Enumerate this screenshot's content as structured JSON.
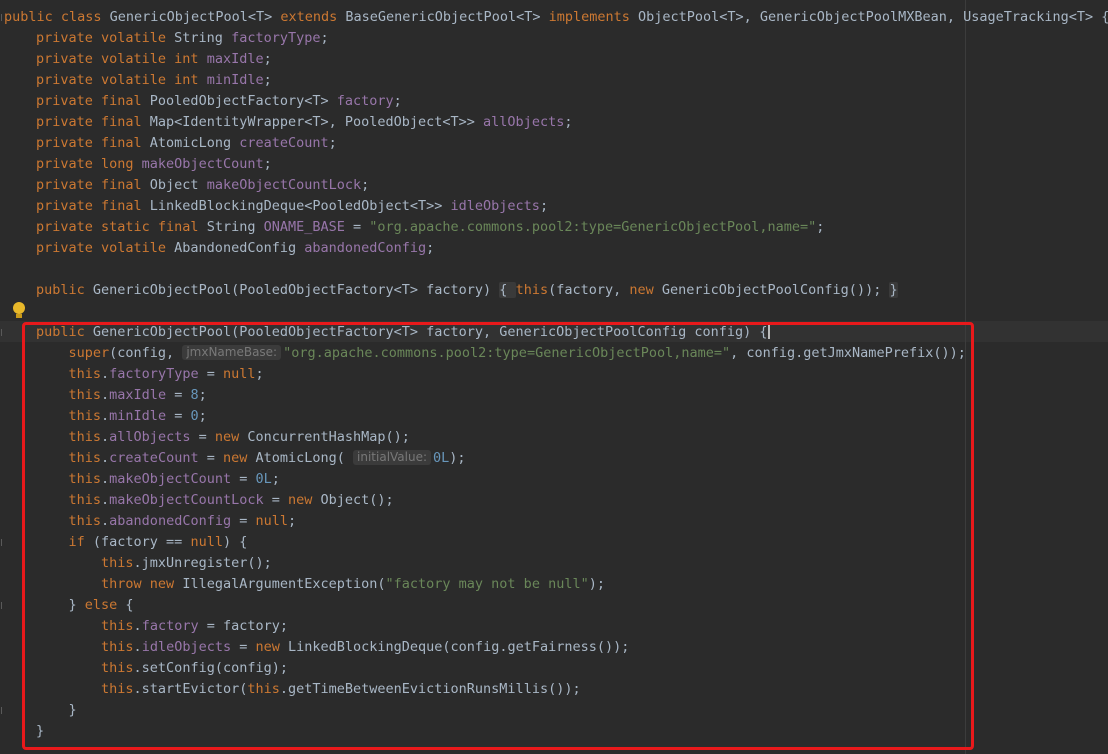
{
  "editor": {
    "lines": [
      {
        "tokens": [
          [
            "kw",
            "public class "
          ],
          [
            "id",
            "GenericObjectPool<T> "
          ],
          [
            "kw",
            "extends "
          ],
          [
            "id",
            "BaseGenericObjectPool<T> "
          ],
          [
            "kw",
            "implements "
          ],
          [
            "id",
            "ObjectPool<T>, GenericObjectPoolMXBean, UsageTracking<T> {"
          ]
        ]
      },
      {
        "tokens": [
          [
            "kw",
            "private volatile "
          ],
          [
            "id",
            "String "
          ],
          [
            "fld",
            "factoryType"
          ],
          [
            "id",
            ";"
          ]
        ]
      },
      {
        "tokens": [
          [
            "kw",
            "private volatile int "
          ],
          [
            "fld",
            "maxIdle"
          ],
          [
            "id",
            ";"
          ]
        ]
      },
      {
        "tokens": [
          [
            "kw",
            "private volatile int "
          ],
          [
            "fld",
            "minIdle"
          ],
          [
            "id",
            ";"
          ]
        ]
      },
      {
        "tokens": [
          [
            "kw",
            "private final "
          ],
          [
            "id",
            "PooledObjectFactory<T> "
          ],
          [
            "fld",
            "factory"
          ],
          [
            "id",
            ";"
          ]
        ]
      },
      {
        "tokens": [
          [
            "kw",
            "private final "
          ],
          [
            "id",
            "Map<IdentityWrapper<T>, PooledObject<T>> "
          ],
          [
            "fld",
            "allObjects"
          ],
          [
            "id",
            ";"
          ]
        ]
      },
      {
        "tokens": [
          [
            "kw",
            "private final "
          ],
          [
            "id",
            "AtomicLong "
          ],
          [
            "fld",
            "createCount"
          ],
          [
            "id",
            ";"
          ]
        ]
      },
      {
        "tokens": [
          [
            "kw",
            "private long "
          ],
          [
            "fld",
            "makeObjectCount"
          ],
          [
            "id",
            ";"
          ]
        ]
      },
      {
        "tokens": [
          [
            "kw",
            "private final "
          ],
          [
            "id",
            "Object "
          ],
          [
            "fld",
            "makeObjectCountLock"
          ],
          [
            "id",
            ";"
          ]
        ]
      },
      {
        "tokens": [
          [
            "kw",
            "private final "
          ],
          [
            "id",
            "LinkedBlockingDeque<PooledObject<T>> "
          ],
          [
            "fld",
            "idleObjects"
          ],
          [
            "id",
            ";"
          ]
        ]
      },
      {
        "tokens": [
          [
            "kw",
            "private static final "
          ],
          [
            "id",
            "String "
          ],
          [
            "fld",
            "ONAME_BASE"
          ],
          [
            "id",
            " = "
          ],
          [
            "str",
            "\"org.apache.commons.pool2:type=GenericObjectPool,name=\""
          ],
          [
            "id",
            ";"
          ]
        ]
      },
      {
        "tokens": [
          [
            "kw",
            "private volatile "
          ],
          [
            "id",
            "AbandonedConfig "
          ],
          [
            "fld",
            "abandonedConfig"
          ],
          [
            "id",
            ";"
          ]
        ]
      },
      {
        "tokens": []
      },
      {
        "tokens": [
          [
            "kw",
            "public "
          ],
          [
            "id",
            "GenericObjectPool(PooledObjectFactory<T> factory) "
          ],
          [
            "fold",
            "{ "
          ],
          [
            "kw",
            "this"
          ],
          [
            "id",
            "(factory, "
          ],
          [
            "kw",
            "new "
          ],
          [
            "id",
            "GenericObjectPoolConfig()); "
          ],
          [
            "fold",
            "}"
          ]
        ]
      },
      {
        "tokens": []
      },
      {
        "tokens": [
          [
            "kw",
            "public "
          ],
          [
            "id",
            "GenericObjectPool(PooledObjectFactory<T> factory, GenericObjectPoolConfig config) {"
          ],
          [
            "caret",
            ""
          ]
        ]
      },
      {
        "tokens": [
          [
            "ind",
            "    "
          ],
          [
            "kw",
            "super"
          ],
          [
            "id",
            "(config, "
          ],
          [
            "hint",
            "jmxNameBase:"
          ],
          [
            "str",
            "\"org.apache.commons.pool2:type=GenericObjectPool,name=\""
          ],
          [
            "id",
            ", config.getJmxNamePrefix());"
          ]
        ]
      },
      {
        "tokens": [
          [
            "ind",
            "    "
          ],
          [
            "kw",
            "this"
          ],
          [
            "id",
            "."
          ],
          [
            "fld",
            "factoryType"
          ],
          [
            "id",
            " = "
          ],
          [
            "kw",
            "null"
          ],
          [
            "id",
            ";"
          ]
        ]
      },
      {
        "tokens": [
          [
            "ind",
            "    "
          ],
          [
            "kw",
            "this"
          ],
          [
            "id",
            "."
          ],
          [
            "fld",
            "maxIdle"
          ],
          [
            "id",
            " = "
          ],
          [
            "num",
            "8"
          ],
          [
            "id",
            ";"
          ]
        ]
      },
      {
        "tokens": [
          [
            "ind",
            "    "
          ],
          [
            "kw",
            "this"
          ],
          [
            "id",
            "."
          ],
          [
            "fld",
            "minIdle"
          ],
          [
            "id",
            " = "
          ],
          [
            "num",
            "0"
          ],
          [
            "id",
            ";"
          ]
        ]
      },
      {
        "tokens": [
          [
            "ind",
            "    "
          ],
          [
            "kw",
            "this"
          ],
          [
            "id",
            "."
          ],
          [
            "fld",
            "allObjects"
          ],
          [
            "id",
            " = "
          ],
          [
            "kw",
            "new "
          ],
          [
            "id",
            "ConcurrentHashMap();"
          ]
        ]
      },
      {
        "tokens": [
          [
            "ind",
            "    "
          ],
          [
            "kw",
            "this"
          ],
          [
            "id",
            "."
          ],
          [
            "fld",
            "createCount"
          ],
          [
            "id",
            " = "
          ],
          [
            "kw",
            "new "
          ],
          [
            "id",
            "AtomicLong( "
          ],
          [
            "hint",
            "initialValue:"
          ],
          [
            "num",
            "0L"
          ],
          [
            "id",
            ");"
          ]
        ]
      },
      {
        "tokens": [
          [
            "ind",
            "    "
          ],
          [
            "kw",
            "this"
          ],
          [
            "id",
            "."
          ],
          [
            "fld",
            "makeObjectCount"
          ],
          [
            "id",
            " = "
          ],
          [
            "num",
            "0L"
          ],
          [
            "id",
            ";"
          ]
        ]
      },
      {
        "tokens": [
          [
            "ind",
            "    "
          ],
          [
            "kw",
            "this"
          ],
          [
            "id",
            "."
          ],
          [
            "fld",
            "makeObjectCountLock"
          ],
          [
            "id",
            " = "
          ],
          [
            "kw",
            "new "
          ],
          [
            "id",
            "Object();"
          ]
        ]
      },
      {
        "tokens": [
          [
            "ind",
            "    "
          ],
          [
            "kw",
            "this"
          ],
          [
            "id",
            "."
          ],
          [
            "fld",
            "abandonedConfig"
          ],
          [
            "id",
            " = "
          ],
          [
            "kw",
            "null"
          ],
          [
            "id",
            ";"
          ]
        ]
      },
      {
        "tokens": [
          [
            "ind",
            "    "
          ],
          [
            "kw",
            "if "
          ],
          [
            "id",
            "(factory == "
          ],
          [
            "kw",
            "null"
          ],
          [
            "id",
            ") {"
          ]
        ]
      },
      {
        "tokens": [
          [
            "ind",
            "        "
          ],
          [
            "kw",
            "this"
          ],
          [
            "id",
            ".jmxUnregister();"
          ]
        ]
      },
      {
        "tokens": [
          [
            "ind",
            "        "
          ],
          [
            "kw",
            "throw new "
          ],
          [
            "id",
            "IllegalArgumentException("
          ],
          [
            "str",
            "\"factory may not be null\""
          ],
          [
            "id",
            ");"
          ]
        ]
      },
      {
        "tokens": [
          [
            "ind",
            "    "
          ],
          [
            "id",
            "} "
          ],
          [
            "kw",
            "else "
          ],
          [
            "id",
            "{"
          ]
        ]
      },
      {
        "tokens": [
          [
            "ind",
            "        "
          ],
          [
            "kw",
            "this"
          ],
          [
            "id",
            "."
          ],
          [
            "fld",
            "factory"
          ],
          [
            "id",
            " = factory;"
          ]
        ]
      },
      {
        "tokens": [
          [
            "ind",
            "        "
          ],
          [
            "kw",
            "this"
          ],
          [
            "id",
            "."
          ],
          [
            "fld",
            "idleObjects"
          ],
          [
            "id",
            " = "
          ],
          [
            "kw",
            "new "
          ],
          [
            "id",
            "LinkedBlockingDeque(config.getFairness());"
          ]
        ]
      },
      {
        "tokens": [
          [
            "ind",
            "        "
          ],
          [
            "kw",
            "this"
          ],
          [
            "id",
            ".setConfig(config);"
          ]
        ]
      },
      {
        "tokens": [
          [
            "ind",
            "        "
          ],
          [
            "kw",
            "this"
          ],
          [
            "id",
            ".startEvictor("
          ],
          [
            "kw",
            "this"
          ],
          [
            "id",
            ".getTimeBetweenEvictionRunsMillis());"
          ]
        ]
      },
      {
        "tokens": [
          [
            "ind",
            "    "
          ],
          [
            "id",
            "}"
          ]
        ]
      },
      {
        "tokens": [
          [
            "id",
            "}"
          ]
        ]
      }
    ]
  }
}
